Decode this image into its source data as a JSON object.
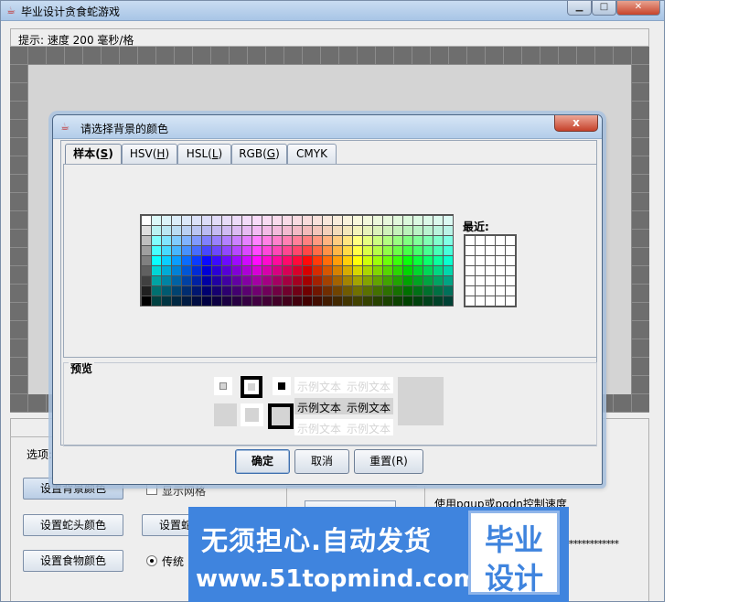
{
  "main_window": {
    "title": "毕业设计贪食蛇游戏",
    "hint": "提示: 速度 200 毫秒/格",
    "options_label": "选项:",
    "buttons": {
      "set_bg_color": "设置背景颜色",
      "set_head_color": "设置蛇头颜色",
      "set_body_color": "设置蛇",
      "set_food_color": "设置食物颜色"
    },
    "show_grid": "显示网格",
    "traditional": "传统",
    "speed_hint": "使用pgup或pgdn控制速度",
    "stars": "**************"
  },
  "dialog": {
    "title": "请选择背景的颜色",
    "close_label": "x",
    "tabs": [
      {
        "label": "样本",
        "mnemonic": "S"
      },
      {
        "label": "HSV",
        "mnemonic": "H"
      },
      {
        "label": "HSL",
        "mnemonic": "L"
      },
      {
        "label": "RGB",
        "mnemonic": "G"
      },
      {
        "label": "CMYK",
        "mnemonic": "M"
      }
    ],
    "recent_label": "最近:",
    "preview_label": "预览",
    "sample_text": "示例文本",
    "ok": "确定",
    "cancel": "取消",
    "reset": "重置(R)"
  },
  "watermark": {
    "line1": "无须担心.自动发货",
    "line2": "www.51topmind.com",
    "badge_line1": "毕业",
    "badge_line2": "设计"
  },
  "colors": {
    "board": "#d4d4d4",
    "border": "#6e6e6e",
    "watermark": "#3f84de"
  }
}
